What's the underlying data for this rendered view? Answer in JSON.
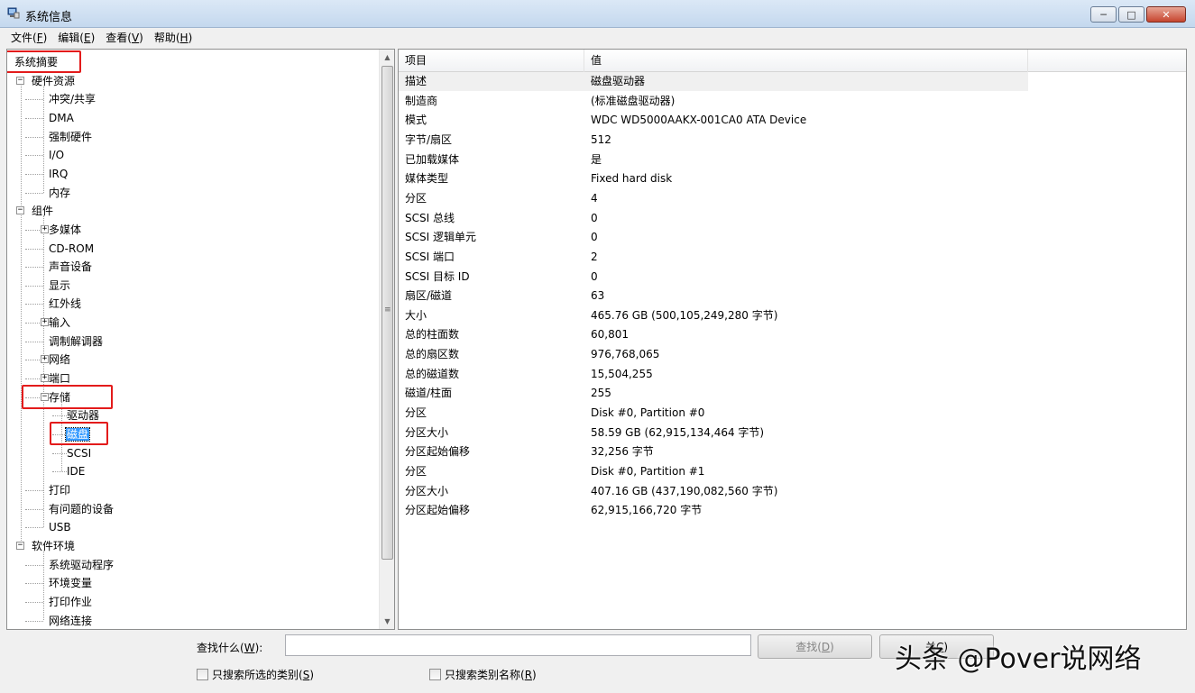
{
  "window": {
    "title": "系统信息",
    "buttons": {
      "minimize": "─",
      "maximize": "□",
      "close": "✕"
    }
  },
  "menu": [
    {
      "text": "文件(",
      "key": "F",
      "close": ")"
    },
    {
      "text": "编辑(",
      "key": "E",
      "close": ")"
    },
    {
      "text": "查看(",
      "key": "V",
      "close": ")"
    },
    {
      "text": "帮助(",
      "key": "H",
      "close": ")"
    }
  ],
  "tree": [
    {
      "label": "系统摘要",
      "level": 0,
      "toggle": null,
      "highlight": true
    },
    {
      "label": "硬件资源",
      "level": 0,
      "toggle": "−"
    },
    {
      "label": "冲突/共享",
      "level": 1,
      "toggle": null
    },
    {
      "label": "DMA",
      "level": 1,
      "toggle": null
    },
    {
      "label": "强制硬件",
      "level": 1,
      "toggle": null
    },
    {
      "label": "I/O",
      "level": 1,
      "toggle": null
    },
    {
      "label": "IRQ",
      "level": 1,
      "toggle": null
    },
    {
      "label": "内存",
      "level": 1,
      "toggle": null
    },
    {
      "label": "组件",
      "level": 0,
      "toggle": "−"
    },
    {
      "label": "多媒体",
      "level": 1,
      "toggle": "+"
    },
    {
      "label": "CD-ROM",
      "level": 1,
      "toggle": null
    },
    {
      "label": "声音设备",
      "level": 1,
      "toggle": null
    },
    {
      "label": "显示",
      "level": 1,
      "toggle": null
    },
    {
      "label": "红外线",
      "level": 1,
      "toggle": null
    },
    {
      "label": "输入",
      "level": 1,
      "toggle": "+"
    },
    {
      "label": "调制解调器",
      "level": 1,
      "toggle": null
    },
    {
      "label": "网络",
      "level": 1,
      "toggle": "+"
    },
    {
      "label": "端口",
      "level": 1,
      "toggle": "+"
    },
    {
      "label": "存储",
      "level": 1,
      "toggle": "−",
      "highlight": true
    },
    {
      "label": "驱动器",
      "level": 2,
      "toggle": null
    },
    {
      "label": "磁盘",
      "level": 2,
      "toggle": null,
      "selected": true,
      "highlight": true
    },
    {
      "label": "SCSI",
      "level": 2,
      "toggle": null
    },
    {
      "label": "IDE",
      "level": 2,
      "toggle": null
    },
    {
      "label": "打印",
      "level": 1,
      "toggle": null
    },
    {
      "label": "有问题的设备",
      "level": 1,
      "toggle": null
    },
    {
      "label": "USB",
      "level": 1,
      "toggle": null
    },
    {
      "label": "软件环境",
      "level": 0,
      "toggle": "−"
    },
    {
      "label": "系统驱动程序",
      "level": 1,
      "toggle": null
    },
    {
      "label": "环境变量",
      "level": 1,
      "toggle": null
    },
    {
      "label": "打印作业",
      "level": 1,
      "toggle": null
    },
    {
      "label": "网络连接",
      "level": 1,
      "toggle": null
    }
  ],
  "list": {
    "columns": [
      "项目",
      "值"
    ],
    "rows": [
      [
        "描述",
        "磁盘驱动器"
      ],
      [
        "制造商",
        "(标准磁盘驱动器)"
      ],
      [
        "模式",
        "WDC WD5000AAKX-001CA0 ATA Device"
      ],
      [
        "字节/扇区",
        "512"
      ],
      [
        "已加载媒体",
        "是"
      ],
      [
        "媒体类型",
        "Fixed hard disk"
      ],
      [
        "分区",
        "4"
      ],
      [
        "SCSI 总线",
        "0"
      ],
      [
        "SCSI 逻辑单元",
        "0"
      ],
      [
        "SCSI 端口",
        "2"
      ],
      [
        "SCSI 目标 ID",
        "0"
      ],
      [
        "扇区/磁道",
        "63"
      ],
      [
        "大小",
        "465.76 GB (500,105,249,280 字节)"
      ],
      [
        "总的柱面数",
        "60,801"
      ],
      [
        "总的扇区数",
        "976,768,065"
      ],
      [
        "总的磁道数",
        "15,504,255"
      ],
      [
        "磁道/柱面",
        "255"
      ],
      [
        "分区",
        "Disk #0, Partition #0"
      ],
      [
        "分区大小",
        "58.59 GB (62,915,134,464 字节)"
      ],
      [
        "分区起始偏移",
        "32,256 字节"
      ],
      [
        "分区",
        "Disk #0, Partition #1"
      ],
      [
        "分区大小",
        "407.16 GB (437,190,082,560 字节)"
      ],
      [
        "分区起始偏移",
        "62,915,166,720 字节"
      ]
    ]
  },
  "search": {
    "label_pre": "查找什么(",
    "label_key": "W",
    "label_post": "):",
    "value": "",
    "find_pre": "查找(",
    "find_key": "D",
    "find_post": ")",
    "close_pre": "关",
    "close_key": "C",
    "close_post": ")"
  },
  "options": {
    "selected_only_pre": "只搜索所选的类别(",
    "selected_only_key": "S",
    "selected_only_post": ")",
    "names_only_pre": "只搜索类别名称(",
    "names_only_key": "R",
    "names_only_post": ")"
  },
  "watermark": "头条 @Pover说网络"
}
